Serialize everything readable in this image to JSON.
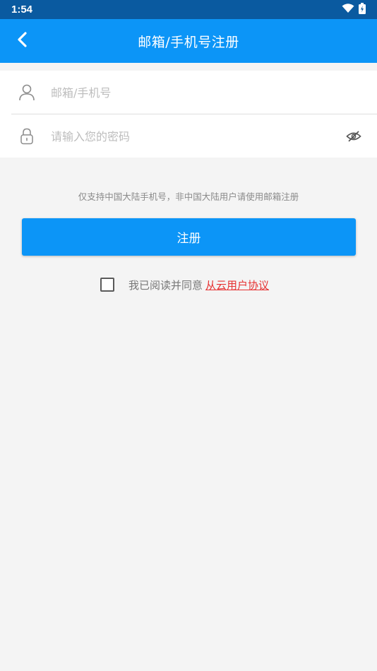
{
  "status_bar": {
    "time": "1:54"
  },
  "app_bar": {
    "title": "邮箱/手机号注册",
    "back_icon": "chevron-left-icon"
  },
  "form": {
    "account": {
      "placeholder": "邮箱/手机号",
      "value": "",
      "icon": "user-icon"
    },
    "password": {
      "placeholder": "请输入您的密码",
      "value": "",
      "icon": "lock-icon",
      "toggle_icon": "eye-off-icon"
    }
  },
  "hint": "仅支持中国大陆手机号，非中国大陆用户请使用邮箱注册",
  "register_button": "注册",
  "agreement": {
    "text": "我已阅读并同意",
    "link": "从云用户协议",
    "checked": false
  },
  "colors": {
    "status_bar": "#0a5aa0",
    "primary": "#0c95f7",
    "link": "#e63232",
    "background": "#f4f4f4"
  }
}
